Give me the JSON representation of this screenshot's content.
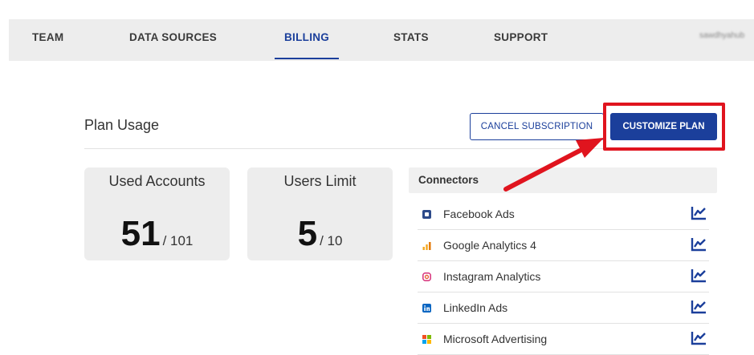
{
  "nav": {
    "tabs": [
      {
        "label": "TEAM"
      },
      {
        "label": "DATA SOURCES"
      },
      {
        "label": "BILLING",
        "active": true
      },
      {
        "label": "STATS"
      },
      {
        "label": "SUPPORT"
      }
    ],
    "user": "sawdhyahub"
  },
  "plan": {
    "title": "Plan Usage",
    "cancel_label": "CANCEL SUBSCRIPTION",
    "customize_label": "CUSTOMIZE PLAN"
  },
  "cards": [
    {
      "title": "Used Accounts",
      "value": "51",
      "limit": "/ 101"
    },
    {
      "title": "Users Limit",
      "value": "5",
      "limit": "/ 10"
    }
  ],
  "connectors": {
    "title": "Connectors",
    "items": [
      {
        "name": "Facebook Ads",
        "icon": "facebook-ads-icon"
      },
      {
        "name": "Google Analytics 4",
        "icon": "google-analytics-icon"
      },
      {
        "name": "Instagram Analytics",
        "icon": "instagram-icon"
      },
      {
        "name": "LinkedIn Ads",
        "icon": "linkedin-icon"
      },
      {
        "name": "Microsoft Advertising",
        "icon": "microsoft-icon"
      }
    ]
  },
  "colors": {
    "accent": "#1b3f9b",
    "highlight": "#e0141e",
    "nav_bg": "#ededed"
  }
}
